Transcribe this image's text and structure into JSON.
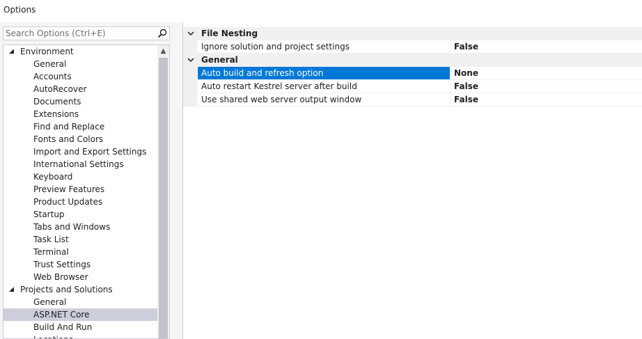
{
  "window": {
    "title": "Options"
  },
  "search": {
    "placeholder": "Search Options (Ctrl+E)"
  },
  "tree": {
    "items": [
      {
        "label": "Environment",
        "type": "parent",
        "expanded": true
      },
      {
        "label": "General",
        "type": "child"
      },
      {
        "label": "Accounts",
        "type": "child"
      },
      {
        "label": "AutoRecover",
        "type": "child"
      },
      {
        "label": "Documents",
        "type": "child"
      },
      {
        "label": "Extensions",
        "type": "child"
      },
      {
        "label": "Find and Replace",
        "type": "child"
      },
      {
        "label": "Fonts and Colors",
        "type": "child"
      },
      {
        "label": "Import and Export Settings",
        "type": "child"
      },
      {
        "label": "International Settings",
        "type": "child"
      },
      {
        "label": "Keyboard",
        "type": "child"
      },
      {
        "label": "Preview Features",
        "type": "child"
      },
      {
        "label": "Product Updates",
        "type": "child"
      },
      {
        "label": "Startup",
        "type": "child"
      },
      {
        "label": "Tabs and Windows",
        "type": "child"
      },
      {
        "label": "Task List",
        "type": "child"
      },
      {
        "label": "Terminal",
        "type": "child"
      },
      {
        "label": "Trust Settings",
        "type": "child"
      },
      {
        "label": "Web Browser",
        "type": "child"
      },
      {
        "label": "Projects and Solutions",
        "type": "parent",
        "expanded": true
      },
      {
        "label": "General",
        "type": "child"
      },
      {
        "label": "ASP.NET Core",
        "type": "child",
        "selected": true
      },
      {
        "label": "Build And Run",
        "type": "child"
      },
      {
        "label": "Locations",
        "type": "child"
      }
    ]
  },
  "grid": {
    "categories": [
      {
        "label": "File Nesting",
        "rows": [
          {
            "name": "Ignore solution and project settings",
            "value": "False"
          }
        ]
      },
      {
        "label": "General",
        "rows": [
          {
            "name": "Auto build and refresh option",
            "value": "None",
            "selected": true
          },
          {
            "name": "Auto restart Kestrel server after build",
            "value": "False"
          },
          {
            "name": "Use shared web server output window",
            "value": "False"
          }
        ]
      }
    ]
  },
  "colors": {
    "selection_blue": "#0078d7",
    "tree_selection": "#cccedb",
    "category_bg": "#f0f0f0"
  },
  "icons": {
    "search": "magnifier-icon",
    "expander": "triangle-expanded-icon",
    "category_chevron": "chevron-down-icon",
    "scroll_up": "scroll-up-arrow-icon"
  }
}
